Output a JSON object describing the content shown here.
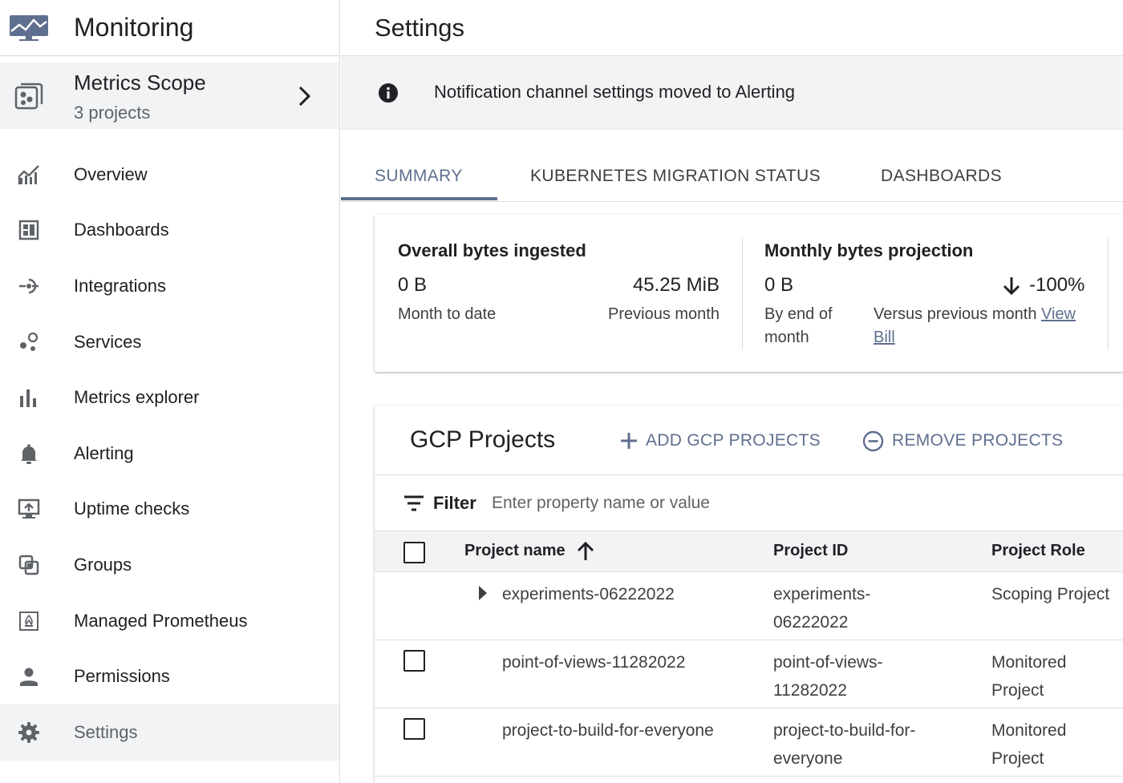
{
  "app": {
    "title": "Monitoring",
    "logo_icon": "monitoring-logo-icon"
  },
  "scope": {
    "title": "Metrics Scope",
    "subtitle": "3 projects",
    "icon": "metrics-scope-icon"
  },
  "sidebar": {
    "items": [
      {
        "label": "Overview",
        "icon": "overview-icon"
      },
      {
        "label": "Dashboards",
        "icon": "dashboards-icon"
      },
      {
        "label": "Integrations",
        "icon": "integrations-icon"
      },
      {
        "label": "Services",
        "icon": "services-icon"
      },
      {
        "label": "Metrics explorer",
        "icon": "bar-chart-icon"
      },
      {
        "label": "Alerting",
        "icon": "bell-icon"
      },
      {
        "label": "Uptime checks",
        "icon": "uptime-icon"
      },
      {
        "label": "Groups",
        "icon": "groups-icon"
      },
      {
        "label": "Managed Prometheus",
        "icon": "prometheus-icon"
      },
      {
        "label": "Permissions",
        "icon": "person-icon"
      },
      {
        "label": "Settings",
        "icon": "gear-icon",
        "active": true
      }
    ]
  },
  "page": {
    "title": "Settings"
  },
  "banner": {
    "text": "Notification channel settings moved to Alerting",
    "icon": "info-icon"
  },
  "tabs": [
    {
      "label": "SUMMARY",
      "active": true
    },
    {
      "label": "KUBERNETES MIGRATION STATUS"
    },
    {
      "label": "DASHBOARDS"
    }
  ],
  "summary": {
    "ingested": {
      "heading": "Overall bytes ingested",
      "current_value": "0 B",
      "current_label": "Month to date",
      "previous_value": "45.25 MiB",
      "previous_label": "Previous month"
    },
    "projection": {
      "heading": "Monthly bytes projection",
      "value": "0 B",
      "value_label": "By end of month",
      "change": "-100%",
      "change_label": "Versus previous month",
      "link_label": "View Bill"
    }
  },
  "projects": {
    "title": "GCP Projects",
    "add_label": "ADD GCP PROJECTS",
    "remove_label": "REMOVE PROJECTS",
    "filter_label": "Filter",
    "filter_placeholder": "Enter property name or value",
    "columns": [
      "Project name",
      "Project ID",
      "Project Role"
    ],
    "rows": [
      {
        "name": "experiments-06222022",
        "id_line1": "experiments-",
        "id_line2": "06222022",
        "role_line1": "Scoping Project",
        "role_line2": ""
      },
      {
        "name": "point-of-views-11282022",
        "id_line1": "point-of-views-",
        "id_line2": "11282022",
        "role_line1": "Monitored",
        "role_line2": "Project"
      },
      {
        "name": "project-to-build-for-everyone",
        "id_line1": "project-to-build-for-",
        "id_line2": "everyone",
        "role_line1": "Monitored",
        "role_line2": "Project"
      }
    ]
  },
  "colors": {
    "accent": "#5f6f8f",
    "icon": "#5f6368",
    "surface": "#f1f3f4",
    "divider": "#dadce0"
  }
}
